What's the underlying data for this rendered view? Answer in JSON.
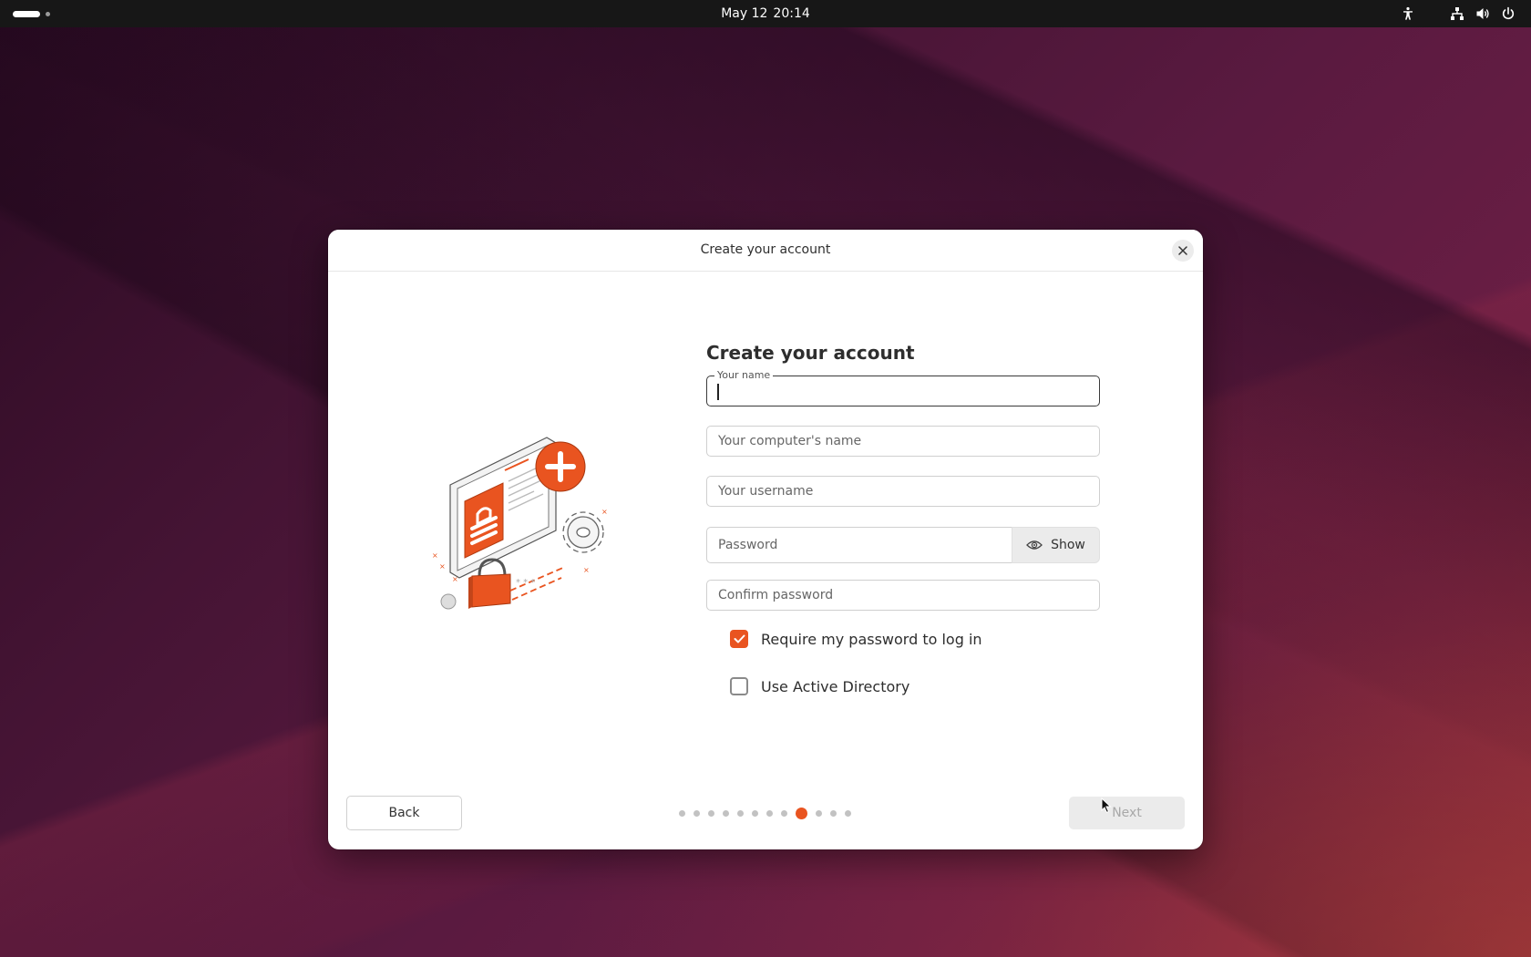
{
  "topbar": {
    "date": "May 12",
    "time": "20:14",
    "workspaces": [
      "workspace-1",
      "workspace-2"
    ],
    "tray_icons": [
      "accessibility-icon",
      "network-icon",
      "volume-icon",
      "power-icon"
    ]
  },
  "dialog": {
    "title": "Create your account",
    "close_icon": "close-icon",
    "illustration": "account-security-illustration"
  },
  "form": {
    "heading": "Create your account",
    "your_name": {
      "label": "Your name",
      "value": ""
    },
    "computer_name": {
      "placeholder": "Your computer's name",
      "value": ""
    },
    "username": {
      "placeholder": "Your username",
      "value": ""
    },
    "password": {
      "placeholder": "Password",
      "value": "",
      "show_label": "Show",
      "show_icon": "eye-icon"
    },
    "confirm_password": {
      "placeholder": "Confirm password",
      "value": ""
    },
    "require_password": {
      "label": "Require my password to log in",
      "checked": true
    },
    "active_directory": {
      "label": "Use Active Directory",
      "checked": false
    }
  },
  "footer": {
    "back_label": "Back",
    "next_label": "Next",
    "next_enabled": false,
    "steps_total": 12,
    "current_step": 9
  },
  "colors": {
    "accent": "#e95420",
    "topbar": "#171717",
    "dialog_bg": "#ffffff"
  }
}
